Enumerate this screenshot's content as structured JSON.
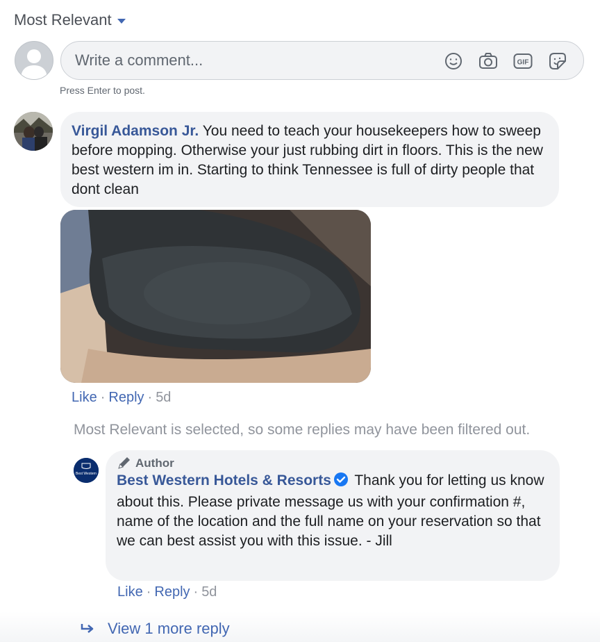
{
  "sort": {
    "label": "Most Relevant"
  },
  "composer": {
    "placeholder": "Write a comment...",
    "hint": "Press Enter to post.",
    "icons": [
      "smiley-icon",
      "camera-icon",
      "gif-icon",
      "sticker-icon"
    ],
    "gif_text": "GIF"
  },
  "comment": {
    "author": "Virgil Adamson Jr.",
    "text": "You need to teach your housekeepers how to sweep before mopping. Otherwise your just rubbing dirt in floors. This is the new best western im in. Starting to think Tennessee is full of dirty people that dont clean",
    "like_label": "Like",
    "reply_label": "Reply",
    "separator": "·",
    "age": "5d"
  },
  "filter_notice": "Most Relevant is selected, so some replies may have been filtered out.",
  "reply": {
    "badge": "Author",
    "author": "Best Western Hotels & Resorts",
    "text": "Thank you for letting us know about this. Please private message us with your confirmation #, name of the location and the full name on your reservation so that we can best assist you with this issue. - Jill",
    "like_label": "Like",
    "reply_label": "Reply",
    "separator": "·",
    "age": "5d",
    "avatar_text": "Best Western"
  },
  "more_replies": "View 1 more reply",
  "colors": {
    "link": "#385898",
    "accent": "#4267b2",
    "bubble": "#f2f3f5",
    "meta": "#90949c",
    "verified": "#1877f2"
  }
}
